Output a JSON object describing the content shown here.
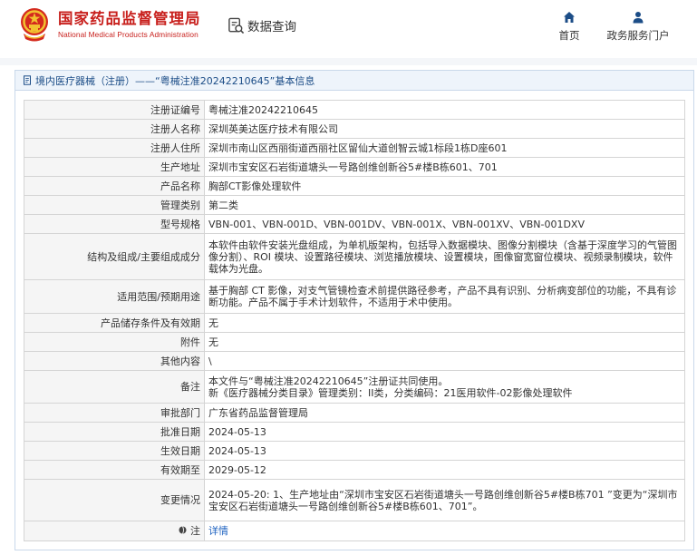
{
  "header": {
    "logo_cn": "国家药品监督管理局",
    "logo_en": "National Medical Products Administration",
    "query_label": "数据查询",
    "nav": {
      "home": "首页",
      "portal": "政务服务门户"
    }
  },
  "panel": {
    "title": "境内医疗器械（注册）——“粤械注准20242210645”基本信息"
  },
  "rows": [
    {
      "key": "注册证编号",
      "value": "粤械注准20242210645"
    },
    {
      "key": "注册人名称",
      "value": "深圳英美达医疗技术有限公司"
    },
    {
      "key": "注册人住所",
      "value": "深圳市南山区西丽街道西丽社区留仙大道创智云城1标段1栋D座601"
    },
    {
      "key": "生产地址",
      "value": "深圳市宝安区石岩街道塘头一号路创维创新谷5#楼B栋601、701"
    },
    {
      "key": "产品名称",
      "value": "胸部CT影像处理软件"
    },
    {
      "key": "管理类别",
      "value": "第二类"
    },
    {
      "key": "型号规格",
      "value": "VBN-001、VBN-001D、VBN-001DV、VBN-001X、VBN-001XV、VBN-001DXV"
    },
    {
      "key": "结构及组成/主要组成成分",
      "value": "本软件由软件安装光盘组成，为单机版架构，包括导入数据模块、图像分割模块（含基于深度学习的气管图像分割）、ROI 模块、设置路径模块、浏览播放模块、设置模块，图像窗宽窗位模块、视频录制模块，软件载体为光盘。"
    },
    {
      "key": "适用范围/预期用途",
      "value": "基于胸部 CT 影像，对支气管镜检查术前提供路径参考，产品不具有识别、分析病变部位的功能，不具有诊断功能。产品不属于手术计划软件，不适用于术中使用。"
    },
    {
      "key": "产品储存条件及有效期",
      "value": "无"
    },
    {
      "key": "附件",
      "value": "无"
    },
    {
      "key": "其他内容",
      "value": "\\"
    },
    {
      "key": "备注",
      "value": "本文件与“粤械注准20242210645”注册证共同使用。\n新《医疗器械分类目录》管理类别：II类，分类编码：21医用软件-02影像处理软件"
    },
    {
      "key": "审批部门",
      "value": "广东省药品监督管理局"
    },
    {
      "key": "批准日期",
      "value": "2024-05-13"
    },
    {
      "key": "生效日期",
      "value": "2024-05-13"
    },
    {
      "key": "有效期至",
      "value": "2029-05-12"
    },
    {
      "key": "变更情况",
      "value": "2024-05-20: 1、生产地址由“深圳市宝安区石岩街道塘头一号路创维创新谷5#楼B栋701 ”变更为“深圳市宝安区石岩街道塘头一号路创维创新谷5#楼B栋601、701”。"
    }
  ],
  "footer_row": {
    "key": "注",
    "link": "详情"
  },
  "colors": {
    "brand_red": "#c8201d",
    "link_blue": "#1e62c0",
    "nav_blue": "#1c4d87"
  },
  "icons": {
    "emblem": "national-emblem-icon",
    "query": "data-query-icon",
    "home": "home-icon",
    "portal": "user-icon",
    "panel": "document-icon",
    "pin": "globe-pin-icon"
  }
}
